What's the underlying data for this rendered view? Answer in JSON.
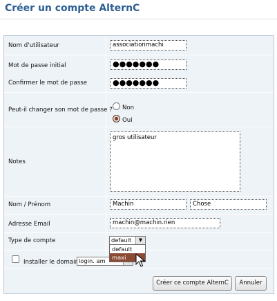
{
  "page": {
    "title": "Créer un compte AlternC"
  },
  "form": {
    "username": {
      "label": "Nom d'utilisateur",
      "value": "associationmachi"
    },
    "password": {
      "label": "Mot de passe initial",
      "value": "●●●●●●●"
    },
    "password_confirm": {
      "label": "Confirmer le mot de passe",
      "value": "●●●●●●●"
    },
    "can_change": {
      "label": "Peut-il changer son mot de passe ?",
      "options": [
        "Non",
        "Oui"
      ],
      "selected": "Oui"
    },
    "notes": {
      "label": "Notes",
      "value": "gros utilisateur"
    },
    "name": {
      "label": "Nom / Prénom",
      "last": "Machin",
      "first": "Chose"
    },
    "email": {
      "label": "Adresse Email",
      "value": "machin@machin.rien"
    },
    "account_type": {
      "label": "Type de compte",
      "value": "default",
      "options": [
        "default",
        "maxi"
      ],
      "highlighted": "maxi"
    },
    "install_domain": {
      "label": "Installer le domaine",
      "value": "login.  am"
    },
    "buttons": {
      "create": "Créer ce compte AlternC",
      "cancel": "Annuler"
    }
  }
}
